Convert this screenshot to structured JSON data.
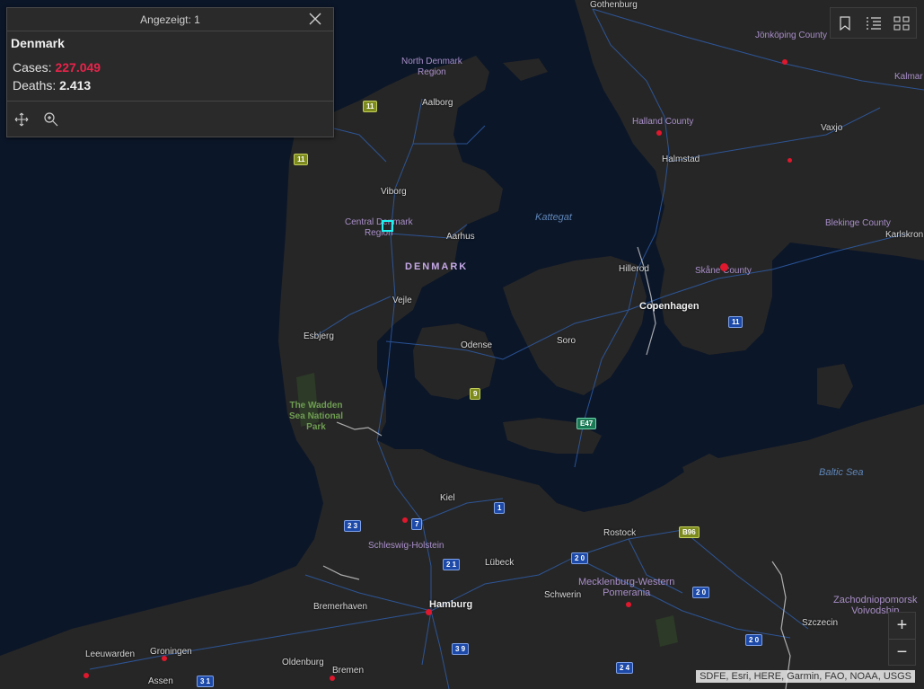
{
  "popup": {
    "header": "Angezeigt: 1",
    "title": "Denmark",
    "cases_label": "Cases: ",
    "cases_value": "227.049",
    "deaths_label": "Deaths: ",
    "deaths_value": "2.413"
  },
  "map": {
    "country_label": "DENMARK",
    "water": {
      "kattegat": "Kattegat",
      "baltic": "Baltic Sea"
    },
    "regions": {
      "north_denmark_1": "North Denmark",
      "north_denmark_2": "Region",
      "central_denmark_1": "Central Denmark",
      "central_denmark_2": "Region",
      "jonkoping": "Jönköping County",
      "halland": "Halland County",
      "blekinge": "Blekinge County",
      "skane": "Skåne County",
      "kalmar": "Kalmar",
      "schleswig": "Schleswig-Holstein",
      "mecklenburg_1": "Mecklenburg-Western",
      "mecklenburg_2": "Pomerania",
      "zachodnio_1": "Zachodniopomorsk",
      "zachodnio_2": "Voivodship"
    },
    "park": {
      "line1": "The Wadden",
      "line2": "Sea National",
      "line3": "Park"
    },
    "cities": {
      "gothenburg": "Gothenburg",
      "aalborg": "Aalborg",
      "viborg": "Viborg",
      "aarhus": "Aarhus",
      "vejle": "Vejle",
      "esbjerg": "Esbjerg",
      "odense": "Odense",
      "hillerod": "Hillerod",
      "copenhagen": "Copenhagen",
      "soro": "Soro",
      "halmstad": "Halmstad",
      "vaxjo": "Vaxjo",
      "karlskrona": "Karlskron",
      "kiel": "Kiel",
      "rostock": "Rostock",
      "lubeck": "Lübeck",
      "hamburg": "Hamburg",
      "schwerin": "Schwerin",
      "bremerhaven": "Bremerhaven",
      "oldenburg": "Oldenburg",
      "bremen": "Bremen",
      "groningen": "Groningen",
      "leeuwarden": "Leeuwarden",
      "assen": "Assen",
      "szczecin": "Szczecin"
    },
    "shields": {
      "s11a": "11",
      "s11b": "11",
      "s11c": "11",
      "s9": "9",
      "sE47": "E47",
      "s1": "1",
      "s7": "7",
      "s23": "2 3",
      "s21": "2 1",
      "s20a": "2 0",
      "s20b": "2 0",
      "s20c": "2 0",
      "sB96": "B96",
      "s39": "3 9",
      "s24": "2 4",
      "s31": "3 1"
    }
  },
  "zoom": {
    "in": "+",
    "out": "−"
  },
  "attribution": "SDFE, Esri, HERE, Garmin, FAO, NOAA, USGS",
  "icons": {
    "close": "close-icon",
    "pan": "move-icon",
    "zoom_to": "zoom-in-icon",
    "bookmarks": "bookmark-icon",
    "layers": "list-icon",
    "basemap": "grid-icon"
  }
}
